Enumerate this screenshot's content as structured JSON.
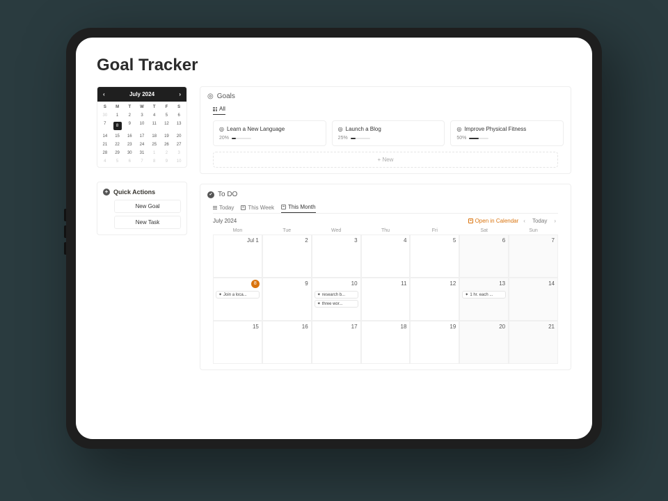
{
  "page": {
    "title": "Goal Tracker"
  },
  "miniCalendar": {
    "monthLabel": "July 2024",
    "dow": [
      "S",
      "M",
      "T",
      "W",
      "T",
      "F",
      "S"
    ],
    "days": [
      {
        "n": "30",
        "muted": true
      },
      {
        "n": "1"
      },
      {
        "n": "2"
      },
      {
        "n": "3"
      },
      {
        "n": "4"
      },
      {
        "n": "5"
      },
      {
        "n": "6"
      },
      {
        "n": "7"
      },
      {
        "n": "8",
        "sel": true
      },
      {
        "n": "9"
      },
      {
        "n": "10"
      },
      {
        "n": "11"
      },
      {
        "n": "12"
      },
      {
        "n": "13"
      },
      {
        "n": "14"
      },
      {
        "n": "15"
      },
      {
        "n": "16"
      },
      {
        "n": "17"
      },
      {
        "n": "18"
      },
      {
        "n": "19"
      },
      {
        "n": "20"
      },
      {
        "n": "21"
      },
      {
        "n": "22"
      },
      {
        "n": "23"
      },
      {
        "n": "24"
      },
      {
        "n": "25"
      },
      {
        "n": "26"
      },
      {
        "n": "27"
      },
      {
        "n": "28"
      },
      {
        "n": "29"
      },
      {
        "n": "30"
      },
      {
        "n": "31"
      },
      {
        "n": "1",
        "muted": true
      },
      {
        "n": "2",
        "muted": true
      },
      {
        "n": "3",
        "muted": true
      },
      {
        "n": "4",
        "muted": true
      },
      {
        "n": "5",
        "muted": true
      },
      {
        "n": "6",
        "muted": true
      },
      {
        "n": "7",
        "muted": true
      },
      {
        "n": "8",
        "muted": true
      },
      {
        "n": "9",
        "muted": true
      },
      {
        "n": "10",
        "muted": true
      }
    ]
  },
  "quickActions": {
    "title": "Quick Actions",
    "buttons": [
      "New Goal",
      "New Task"
    ]
  },
  "goals": {
    "title": "Goals",
    "tabAll": "All",
    "cards": [
      {
        "title": "Learn a New Language",
        "pct": "20%",
        "p": 20
      },
      {
        "title": "Launch a Blog",
        "pct": "25%",
        "p": 25
      },
      {
        "title": "Improve Physical Fitness",
        "pct": "50%",
        "p": 50
      }
    ],
    "newBtn": "New"
  },
  "todo": {
    "title": "To DO",
    "tabs": [
      {
        "label": "Today",
        "icon": "list"
      },
      {
        "label": "This Week",
        "icon": "cal"
      },
      {
        "label": "This Month",
        "icon": "cal",
        "active": true
      }
    ],
    "monthLabel": "July 2024",
    "openCalendar": "Open in Calendar",
    "todayBtn": "Today",
    "dow": [
      "Mon",
      "Tue",
      "Wed",
      "Thu",
      "Fri",
      "Sat",
      "Sun"
    ],
    "cells": [
      {
        "num": "Jul 1",
        "wknd": false
      },
      {
        "num": "2"
      },
      {
        "num": "3"
      },
      {
        "num": "4"
      },
      {
        "num": "5"
      },
      {
        "num": "6",
        "wknd": true
      },
      {
        "num": "7",
        "wknd": true
      },
      {
        "num": "8",
        "badge": true,
        "events": [
          "Join a loca..."
        ]
      },
      {
        "num": "9"
      },
      {
        "num": "10",
        "events": [
          "research b...",
          "three wor..."
        ]
      },
      {
        "num": "11"
      },
      {
        "num": "12"
      },
      {
        "num": "13",
        "wknd": true,
        "events": [
          "1 hr. each ..."
        ]
      },
      {
        "num": "14",
        "wknd": true
      },
      {
        "num": "15"
      },
      {
        "num": "16"
      },
      {
        "num": "17"
      },
      {
        "num": "18"
      },
      {
        "num": "19"
      },
      {
        "num": "20",
        "wknd": true
      },
      {
        "num": "21",
        "wknd": true
      }
    ]
  }
}
